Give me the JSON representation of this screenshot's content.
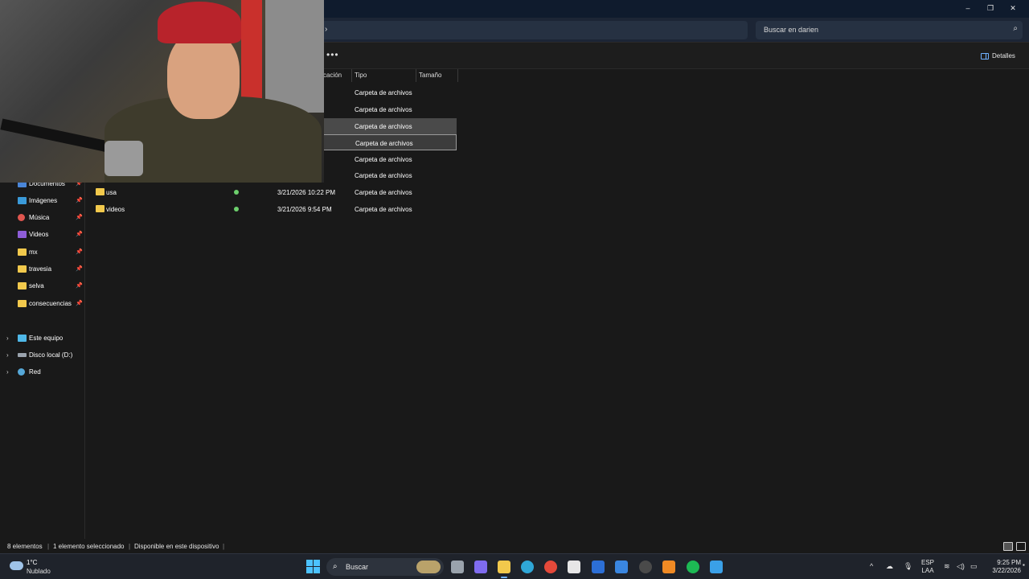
{
  "window": {
    "minimize_glyph": "–",
    "maximize_glyph": "❐",
    "close_glyph": "✕"
  },
  "address": {
    "breadcrumb_chevron": "›"
  },
  "search": {
    "placeholder": "Buscar en darien",
    "icon": "search-icon"
  },
  "toolbar": {
    "more_label": "•••",
    "details_label": "Detalles"
  },
  "columns": {
    "date_partial": "cación",
    "type": "Tipo",
    "size": "Tamaño"
  },
  "files": [
    {
      "name": "",
      "date": "PM",
      "type": "Carpeta de archivos",
      "state": "normal"
    },
    {
      "name": "",
      "date": "PM",
      "type": "Carpeta de archivos",
      "state": "normal"
    },
    {
      "name": "",
      "date": "PM",
      "type": "Carpeta de archivos",
      "state": "selected"
    },
    {
      "name": "",
      "date": "PM",
      "type": "Carpeta de archivos",
      "state": "focused"
    },
    {
      "name": "",
      "date": "PM",
      "type": "Carpeta de archivos",
      "state": "normal"
    },
    {
      "name": "",
      "date": "PM",
      "type": "Carpeta de archivos",
      "state": "normal"
    },
    {
      "name": "usa",
      "date": "3/21/2026 10:22 PM",
      "type": "Carpeta de archivos",
      "state": "normal"
    },
    {
      "name": "videos",
      "date": "3/21/2026 9:54 PM",
      "type": "Carpeta de archivos",
      "state": "normal"
    }
  ],
  "sidebar": {
    "quick_access": [
      {
        "label": "Documentos",
        "icon": "documents-icon"
      },
      {
        "label": "Imágenes",
        "icon": "pictures-icon"
      },
      {
        "label": "Música",
        "icon": "music-icon"
      },
      {
        "label": "Videos",
        "icon": "videos-icon"
      },
      {
        "label": "mx",
        "icon": "folder-icon"
      },
      {
        "label": "travesia",
        "icon": "folder-icon"
      },
      {
        "label": "selva",
        "icon": "folder-icon"
      },
      {
        "label": "consecuencias",
        "icon": "folder-icon"
      }
    ],
    "locations": [
      {
        "label": "Este equipo",
        "icon": "this-pc-icon"
      },
      {
        "label": "Disco local (D:)",
        "icon": "disk-icon"
      },
      {
        "label": "Red",
        "icon": "network-icon"
      }
    ],
    "pin_glyph": "📌",
    "expand_glyph": "›"
  },
  "statusbar": {
    "count": "8 elementos",
    "selection": "1 elemento seleccionado",
    "availability": "Disponible en este dispositivo",
    "sep": "|"
  },
  "taskbar": {
    "weather_temp": "1°C",
    "weather_desc": "Nublado",
    "search_label": "Buscar",
    "tray_chevron": "^",
    "lang_top": "ESP",
    "lang_bottom": "LAA",
    "time": "9:25 PM",
    "date": "3/22/2026",
    "apps": [
      {
        "name": "task-view-icon",
        "color": "#9aa3ad"
      },
      {
        "name": "copilot-icon",
        "color": "#7f6cf0"
      },
      {
        "name": "file-explorer-icon",
        "color": "#f2c94c"
      },
      {
        "name": "edge-icon",
        "color": "#2fa7d8"
      },
      {
        "name": "chrome-icon",
        "color": "#e5493a"
      },
      {
        "name": "store-icon",
        "color": "#e6e6e6"
      },
      {
        "name": "app-blue-icon",
        "color": "#2c6fd6"
      },
      {
        "name": "mail-icon",
        "color": "#3a86e0"
      },
      {
        "name": "obs-icon",
        "color": "#4a4a4a"
      },
      {
        "name": "fl-studio-icon",
        "color": "#f08a24"
      },
      {
        "name": "spotify-icon",
        "color": "#1db954"
      },
      {
        "name": "app-paint-icon",
        "color": "#3aa0e8"
      }
    ]
  }
}
